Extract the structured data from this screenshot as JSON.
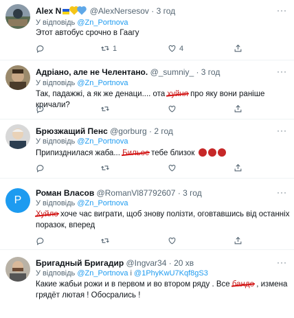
{
  "more_label": "···",
  "tweets": [
    {
      "name": "Alex N",
      "handle": "@AlexNersesov",
      "time": "· 3 год",
      "reply_prefix": "У відповідь",
      "reply_to": "@Zn_Portnova",
      "text": "Этот автобус срочно в Гаагу",
      "counts": {
        "reply": "",
        "retweet": "1",
        "like": "4",
        "share": ""
      }
    },
    {
      "name": "Адріано, але не Челентано.",
      "handle": "@_sumniy_",
      "time": "· 3 год",
      "reply_prefix": "У відповідь",
      "reply_to": "@Zn_Portnova",
      "text_a": "Так, падажжі, а як же денаци.... ота ",
      "redacted": "хуйня",
      "text_b": " про яку вони раніше кричали?"
    },
    {
      "name": "Брюзжащий Пенс",
      "handle": "@gorburg",
      "time": "· 2 год",
      "reply_prefix": "У відповідь",
      "reply_to": "@Zn_Portnova",
      "text_a": "Припизднилася жаба... ",
      "redacted": "Бильос",
      "text_b": " тебе близок"
    },
    {
      "name": "Роман Власов",
      "handle": "@RomanVl87792607",
      "time": "· 3 год",
      "reply_prefix": "У відповідь",
      "reply_to": "@Zn_Portnova",
      "avatar_letter": "P",
      "redacted": "Хуйло",
      "text_a": " хоче час виграти, щоб знову полізти, оговтавшись від останніх",
      "text_b": "поразок, вперед"
    },
    {
      "name": "Бригадный Бригадир",
      "handle": "@Ingvar34",
      "time": "· 20 хв",
      "reply_prefix": "У відповідь",
      "reply_to": "@Zn_Portnova",
      "reply_sep": " і ",
      "reply_to_2": "@1PhyKwU7Kqf8gS3",
      "text_a": "Какие жабьи рожи и в первом и во втором ряду . Все ",
      "redacted": "бандо",
      "text_b": " ,  измена",
      "text_c": "грядёт лютая ! Обосрались !"
    }
  ],
  "colors": {
    "link": "#1d9bf0",
    "muted": "#536471",
    "redaction": "#d51010",
    "roman_avatar": "#1d9bf0"
  },
  "icons": [
    "reply-icon",
    "retweet-icon",
    "like-icon",
    "share-icon",
    "more-icon"
  ]
}
